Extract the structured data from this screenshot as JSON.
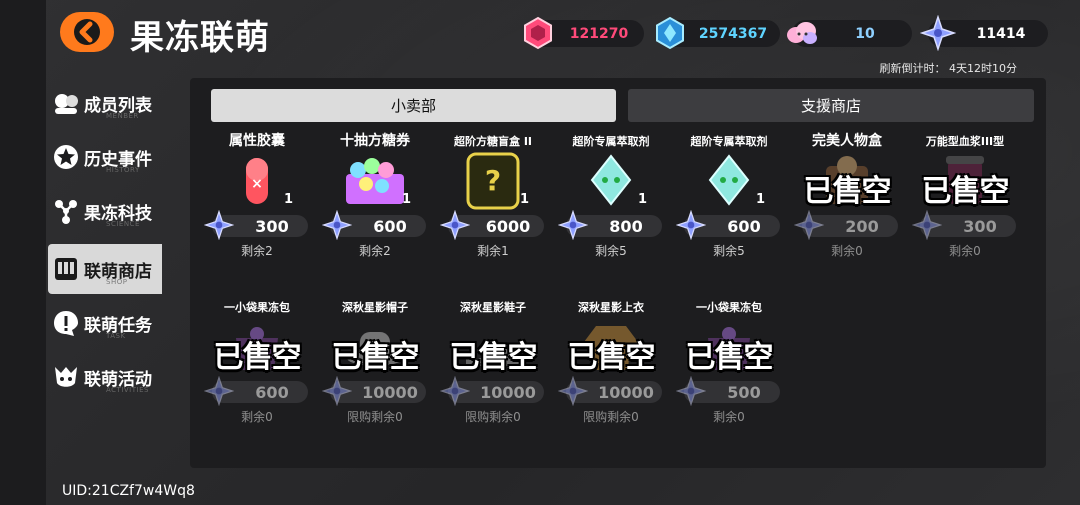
{
  "header": {
    "title": "果冻联萌",
    "currencies": [
      {
        "name": "hex-gem",
        "value": "121270",
        "color": "#ff4a7a"
      },
      {
        "name": "crystal",
        "value": "2574367",
        "color": "#5fd4ff"
      },
      {
        "name": "cloud-candy",
        "value": "10",
        "color": "#ffb0d8"
      },
      {
        "name": "star-shard",
        "value": "11414",
        "color": "#8fa0ff"
      }
    ],
    "timer": "刷新倒计时：  4天12时10分"
  },
  "sidebar": {
    "items": [
      {
        "label": "成员列表",
        "sub": "MENBER",
        "icon": "members-icon"
      },
      {
        "label": "历史事件",
        "sub": "HISTORY",
        "icon": "star-icon"
      },
      {
        "label": "果冻科技",
        "sub": "SCIENCE",
        "icon": "molecule-icon"
      },
      {
        "label": "联萌商店",
        "sub": "SHOP",
        "icon": "shop-icon"
      },
      {
        "label": "联萌任务",
        "sub": "TASK",
        "icon": "task-icon"
      },
      {
        "label": "联萌活动",
        "sub": "ACTIVITIES",
        "icon": "activities-icon"
      }
    ],
    "active_index": 3
  },
  "tabs": [
    {
      "label": "小卖部",
      "active": true
    },
    {
      "label": "支援商店",
      "active": false
    }
  ],
  "shop_items": [
    {
      "name": "属性胶囊",
      "qty": "1",
      "price": "300",
      "remain": "剩余2",
      "sold_out": false,
      "icon": "capsule-icon"
    },
    {
      "name": "十抽方糖券",
      "qty": "1",
      "price": "600",
      "remain": "剩余2",
      "sold_out": false,
      "icon": "sugar-ticket-icon"
    },
    {
      "name": "超阶方糖盲盒 II",
      "qty": "1",
      "price": "6000",
      "remain": "剩余1",
      "sold_out": false,
      "icon": "mystery-box-icon"
    },
    {
      "name": "超阶专属萃取剂",
      "qty": "1",
      "price": "800",
      "remain": "剩余5",
      "sold_out": false,
      "icon": "extract-crystal-icon"
    },
    {
      "name": "超阶专属萃取剂",
      "qty": "1",
      "price": "600",
      "remain": "剩余5",
      "sold_out": false,
      "icon": "extract-crystal-icon"
    },
    {
      "name": "完美人物盒",
      "qty": "",
      "price": "200",
      "remain": "剩余0",
      "sold_out": true,
      "icon": "character-box-icon"
    },
    {
      "name": "万能型血浆III型",
      "qty": "",
      "price": "300",
      "remain": "剩余0",
      "sold_out": true,
      "icon": "plasma-jar-icon"
    },
    {
      "name": "一小袋果冻包",
      "qty": "",
      "price": "600",
      "remain": "剩余0",
      "sold_out": true,
      "icon": "jelly-bag-icon"
    },
    {
      "name": "深秋星影帽子",
      "qty": "",
      "price": "10000",
      "remain": "限购剩余0",
      "sold_out": true,
      "icon": "hat-icon"
    },
    {
      "name": "深秋星影鞋子",
      "qty": "",
      "price": "10000",
      "remain": "限购剩余0",
      "sold_out": true,
      "icon": "shoes-icon"
    },
    {
      "name": "深秋星影上衣",
      "qty": "",
      "price": "10000",
      "remain": "限购剩余0",
      "sold_out": true,
      "icon": "jacket-icon"
    },
    {
      "name": "一小袋果冻包",
      "qty": "",
      "price": "500",
      "remain": "剩余0",
      "sold_out": true,
      "icon": "jelly-bag-icon"
    }
  ],
  "sold_out_label": "已售空",
  "uid": "UID:21CZf7w4Wq8"
}
